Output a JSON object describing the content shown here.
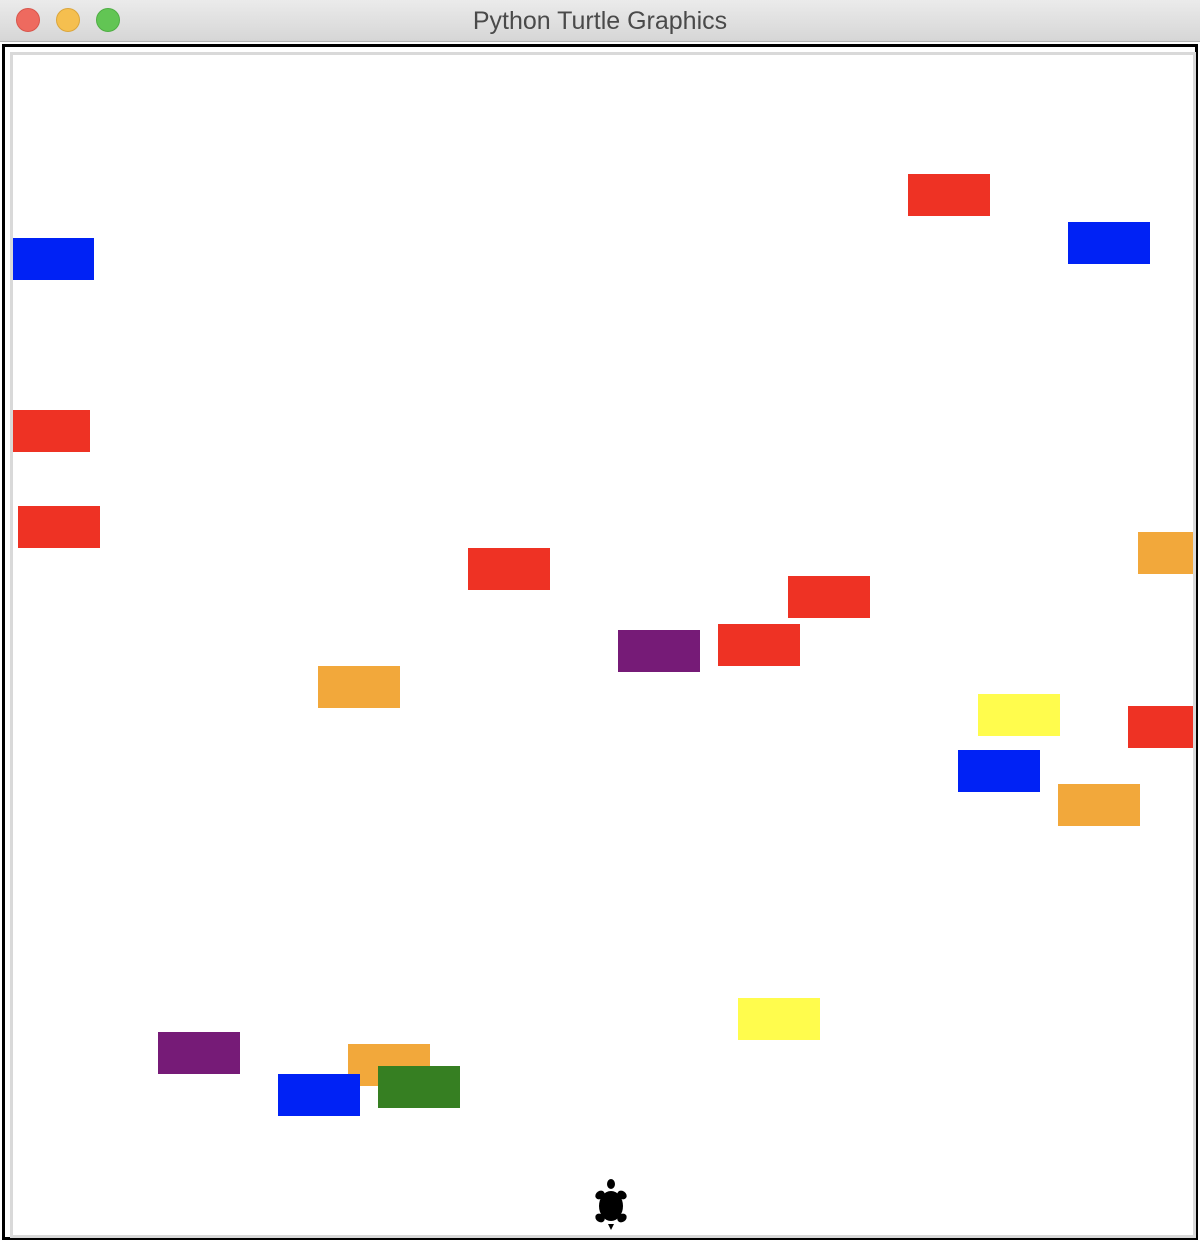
{
  "window": {
    "title": "Python Turtle Graphics"
  },
  "colors": {
    "red": "#ee3224",
    "blue": "#0022f5",
    "orange": "#f2a83b",
    "purple": "#761b77",
    "yellow": "#fffc4d",
    "green": "#367f22",
    "turtle": "#000000"
  },
  "scene": {
    "bricks": [
      {
        "name": "brick-red-1",
        "color": "red"
      },
      {
        "name": "brick-blue-1",
        "color": "blue"
      },
      {
        "name": "brick-blue-2",
        "color": "blue"
      },
      {
        "name": "brick-red-2",
        "color": "red"
      },
      {
        "name": "brick-red-3",
        "color": "red"
      },
      {
        "name": "brick-red-4",
        "color": "red"
      },
      {
        "name": "brick-orange-1",
        "color": "orange"
      },
      {
        "name": "brick-red-5",
        "color": "red"
      },
      {
        "name": "brick-purple-1",
        "color": "purple"
      },
      {
        "name": "brick-red-6",
        "color": "red"
      },
      {
        "name": "brick-orange-2",
        "color": "orange"
      },
      {
        "name": "brick-yellow-1",
        "color": "yellow"
      },
      {
        "name": "brick-red-7",
        "color": "red"
      },
      {
        "name": "brick-blue-3",
        "color": "blue"
      },
      {
        "name": "brick-orange-3",
        "color": "orange"
      },
      {
        "name": "brick-yellow-2",
        "color": "yellow"
      },
      {
        "name": "brick-purple-2",
        "color": "purple"
      },
      {
        "name": "brick-orange-4",
        "color": "orange"
      },
      {
        "name": "brick-blue-4",
        "color": "blue"
      },
      {
        "name": "brick-green-1",
        "color": "green"
      }
    ],
    "player": {
      "icon": "turtle-icon"
    }
  }
}
